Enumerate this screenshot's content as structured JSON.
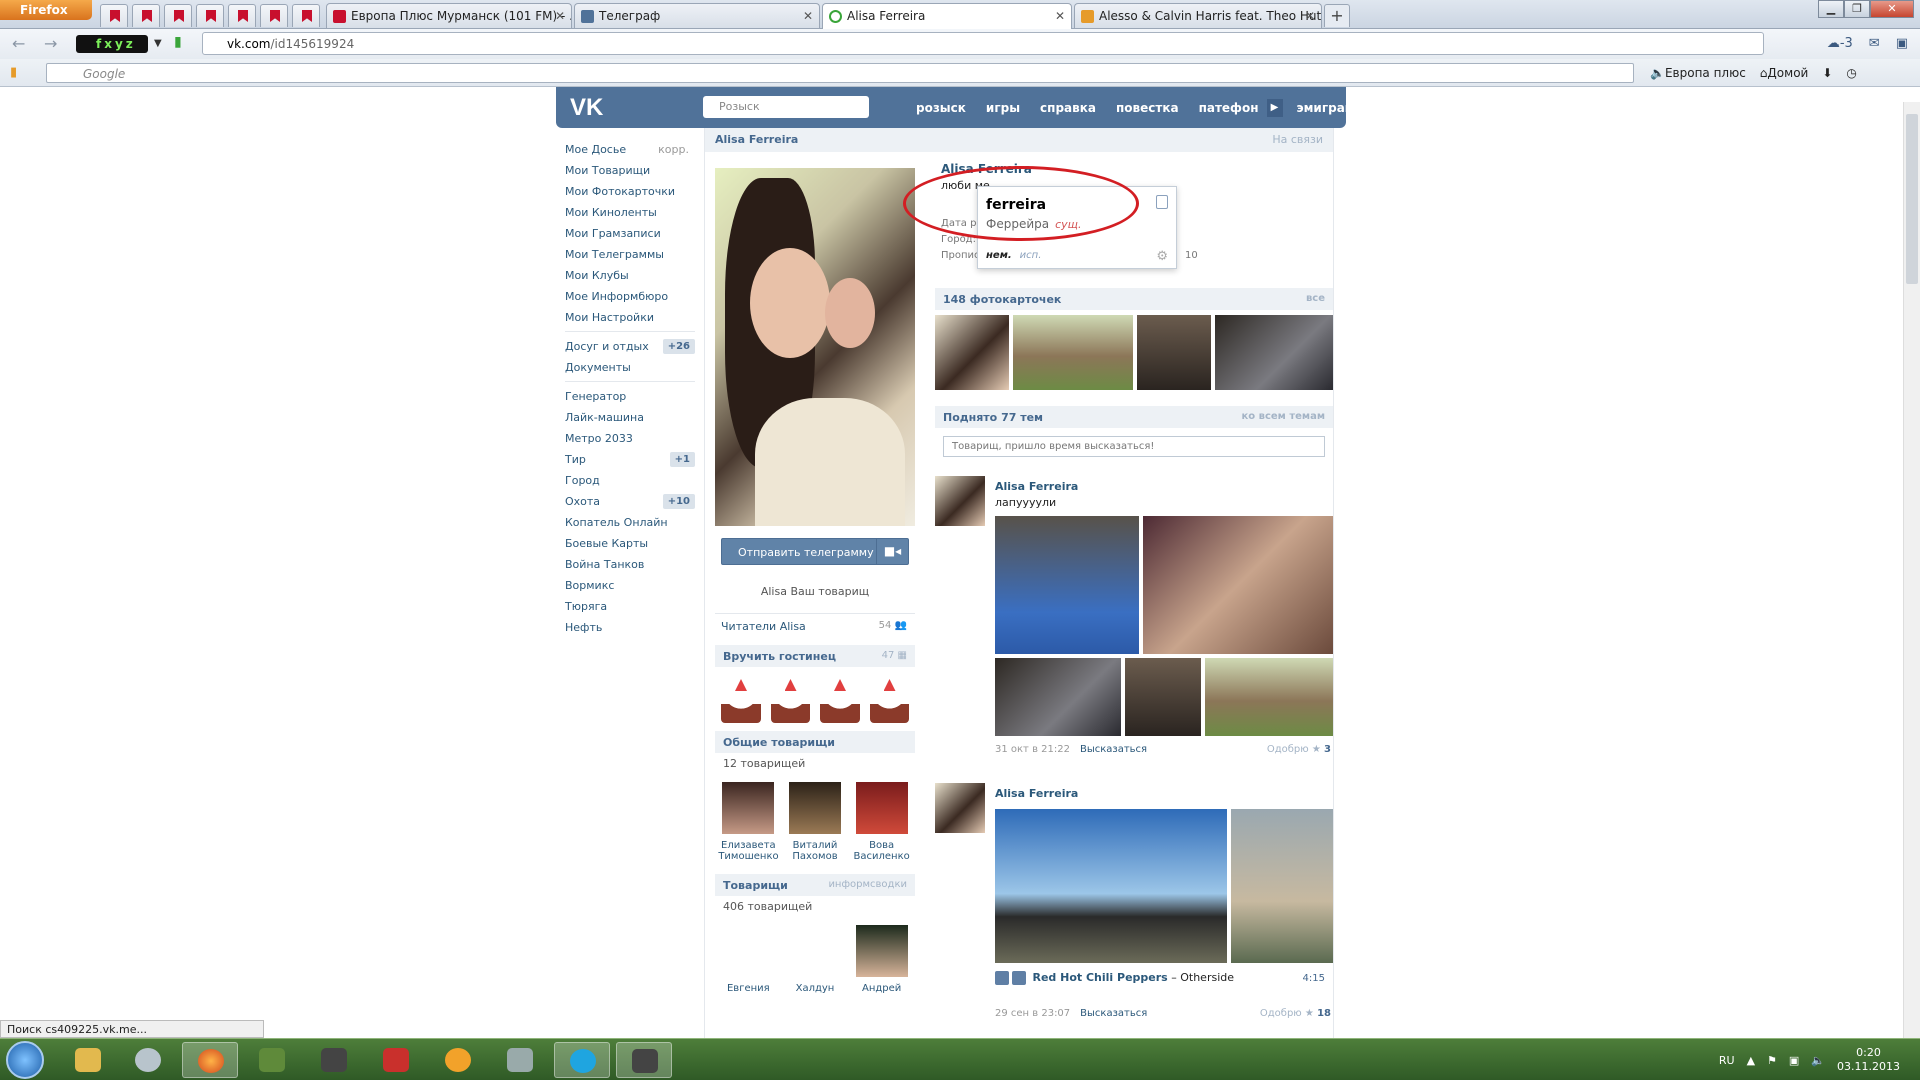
{
  "browser": {
    "menu_label": "Firefox",
    "tabs": [
      {
        "title": "Европа Плюс Мурманск (101 FM) - ...",
        "color": "#c8102e"
      },
      {
        "title": "Телеграф",
        "color": "#507299"
      },
      {
        "title": "Alisa Ferreira",
        "color": "#3aa53a"
      },
      {
        "title": "Alesso & Calvin Harris feat. Theo Hut...",
        "color": "#e69b2a"
      }
    ],
    "url_domain": "vk.com",
    "url_path": "/id145619924",
    "addon_label": "fxyz",
    "search_placeholder": "Google",
    "weather": "-3",
    "bookmarks": [
      "Европа плюс",
      "Домой"
    ],
    "status_text": "Поиск cs409225.vk.me..."
  },
  "vk": {
    "search_placeholder": "Розыск",
    "nav": [
      "розыск",
      "игры",
      "справка",
      "повестка",
      "патефон",
      "эмиграция"
    ],
    "menu": [
      {
        "label": "Мое Досье",
        "side": "корр."
      },
      {
        "label": "Мои Товарищи"
      },
      {
        "label": "Мои Фотокарточки"
      },
      {
        "label": "Мои Киноленты"
      },
      {
        "label": "Мои Грамзаписи"
      },
      {
        "label": "Мои Телеграммы"
      },
      {
        "label": "Мои Клубы"
      },
      {
        "label": "Мое Информбюро"
      },
      {
        "label": "Мои Настройки"
      }
    ],
    "menu2": [
      {
        "label": "Досуг и отдых",
        "count": "+26"
      },
      {
        "label": "Документы"
      }
    ],
    "menu3": [
      {
        "label": "Генератор"
      },
      {
        "label": "Лайк-машина"
      },
      {
        "label": "Метро 2033"
      },
      {
        "label": "Тир",
        "count": "+1"
      },
      {
        "label": "Город"
      },
      {
        "label": "Охота",
        "count": "+10"
      },
      {
        "label": "Копатель Онлайн"
      },
      {
        "label": "Боевые Карты"
      },
      {
        "label": "Война Танков"
      },
      {
        "label": "Вормикс"
      },
      {
        "label": "Тюряга"
      },
      {
        "label": "Нефть"
      }
    ]
  },
  "profile": {
    "page_title": "Alisa Ferreira",
    "online": "На связи",
    "name": "Alisa Ferreira",
    "status": "люби ме",
    "info_labels": [
      "Дата рож",
      "Город:",
      "Прописка:"
    ],
    "info_tail": "10",
    "send_button": "Отправить телеграмму",
    "friend_text": "Alisa Ваш товарищ",
    "readers": "Читатели Alisa",
    "readers_count": "54",
    "gifts_title": "Вручить гостинец",
    "gifts_count": "47",
    "common_title": "Общие товарищи",
    "common_sub": "12 товарищей",
    "common_friends": [
      {
        "first": "Елизавета",
        "last": "Тимошенко"
      },
      {
        "first": "Виталий",
        "last": "Пахомов"
      },
      {
        "first": "Вова",
        "last": "Василенко"
      }
    ],
    "friends_title": "Товарищи",
    "friends_link": "информсводки",
    "friends_sub": "406 товарищей",
    "friends_names": [
      "Евгения",
      "Халдун",
      "Андрей"
    ],
    "photos_title": "148 фотокарточек",
    "photos_link": "все",
    "wall_title": "Поднято 77 тем",
    "wall_link": "ко всем темам",
    "wall_placeholder": "Товарищ, пришло время высказаться!"
  },
  "popup": {
    "word": "ferreira",
    "translation": "Феррейра",
    "pos": "сущ.",
    "lang_from": "нем.",
    "lang_to": "исп."
  },
  "posts": [
    {
      "author": "Alisa Ferreira",
      "text": "лапуууули",
      "date": "31 окт в 21:22",
      "reply": "Высказаться",
      "like_label": "Одобрю",
      "likes": "3"
    },
    {
      "author": "Alisa Ferreira",
      "text": "",
      "audio_artist": "Red Hot Chili Peppers",
      "audio_sep": " – ",
      "audio_title": "Otherside",
      "audio_duration": "4:15",
      "date": "29 сен в 23:07",
      "reply": "Высказаться",
      "like_label": "Одобрю",
      "likes": "18"
    }
  ],
  "taskbar": {
    "lang": "RU",
    "time": "0:20",
    "date": "03.11.2013"
  }
}
